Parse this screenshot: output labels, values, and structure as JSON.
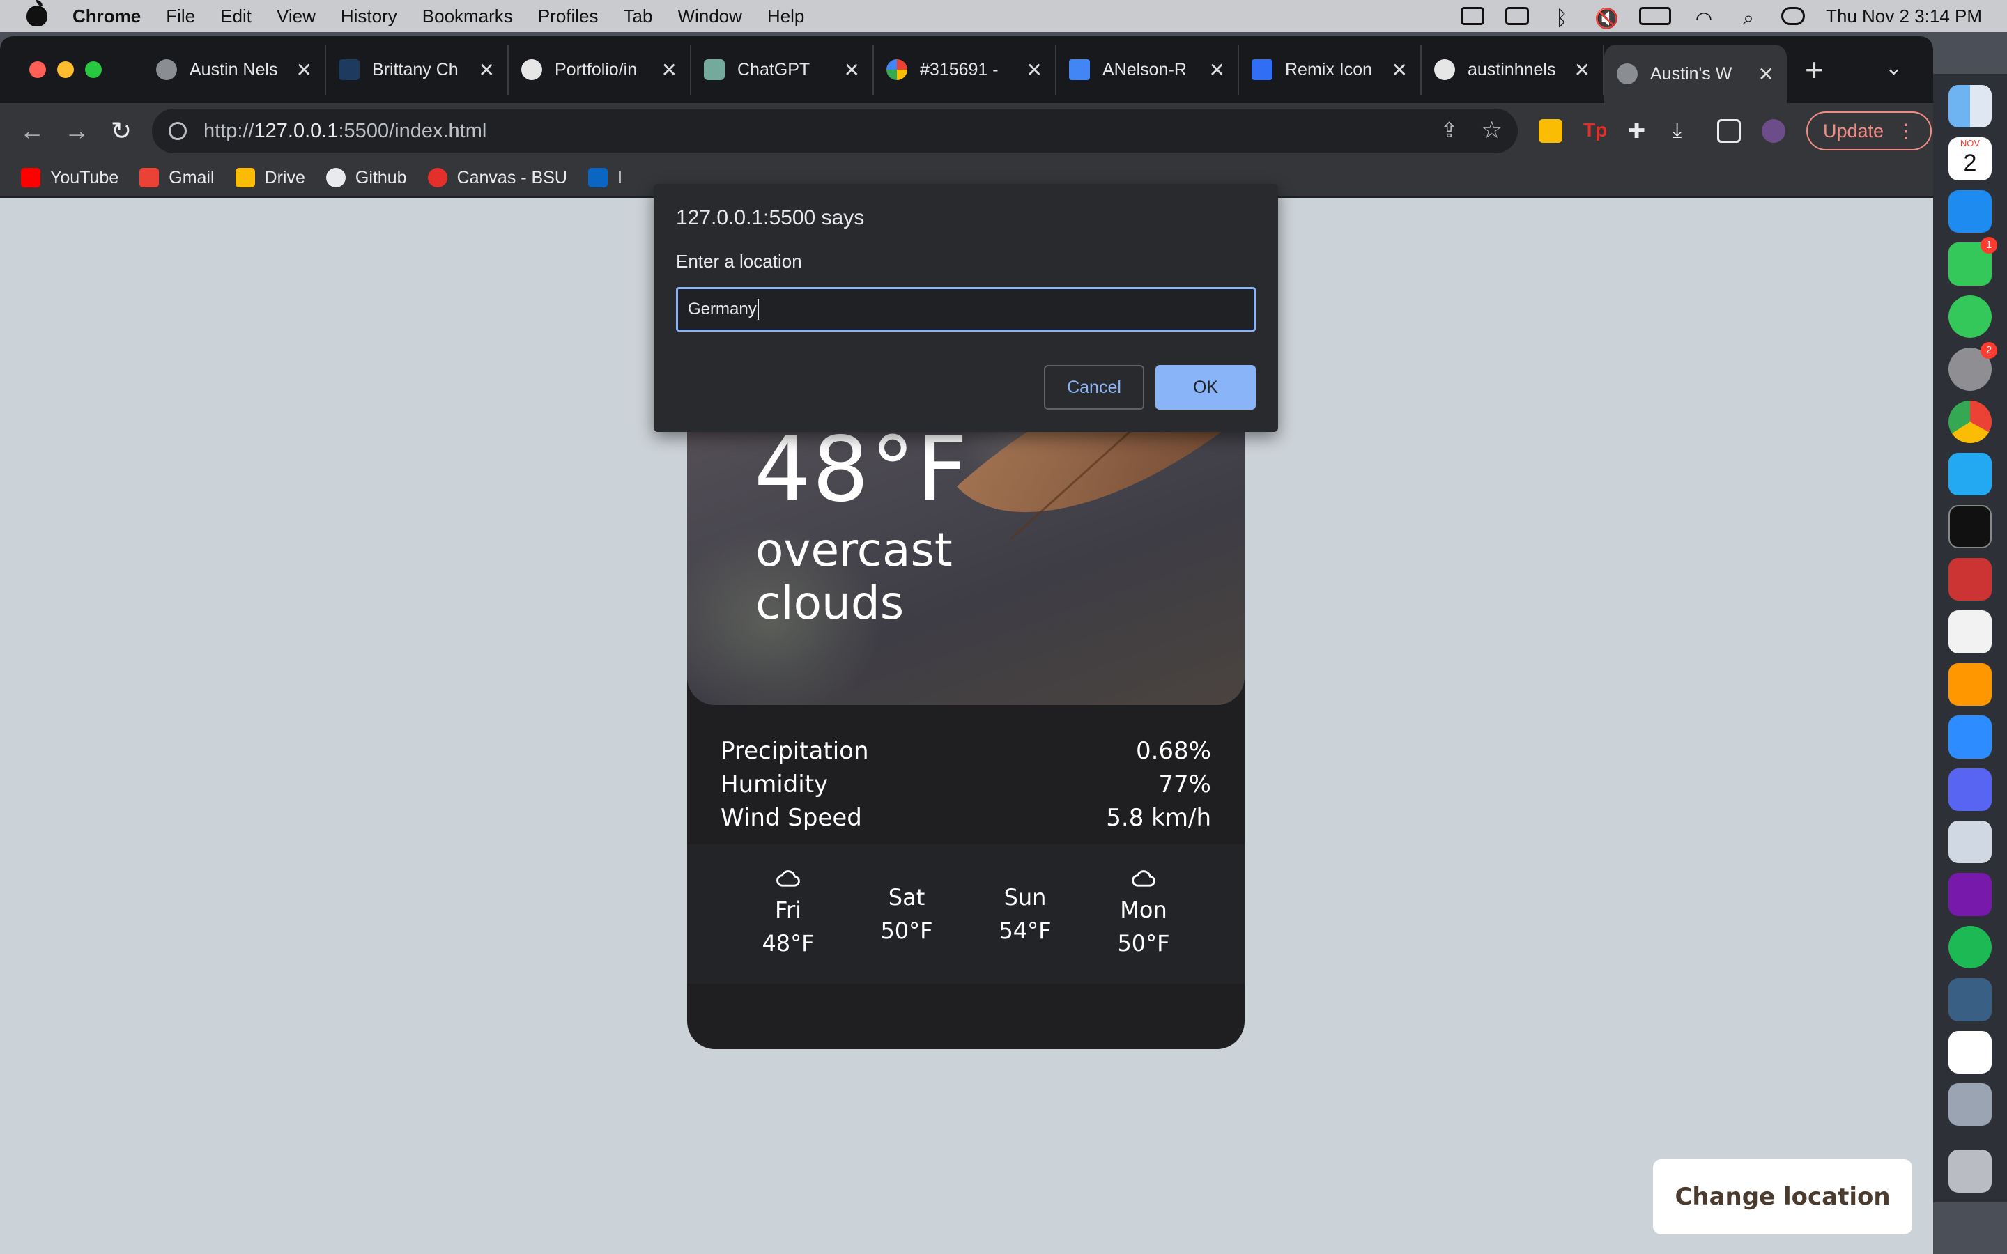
{
  "menubar": {
    "app_name": "Chrome",
    "items": [
      "File",
      "Edit",
      "View",
      "History",
      "Bookmarks",
      "Profiles",
      "Tab",
      "Window",
      "Help"
    ],
    "clock": "Thu Nov 2  3:14 PM"
  },
  "tabs": [
    {
      "label": "Austin Nels",
      "icon": "globe-icon",
      "color": "#8a8d92"
    },
    {
      "label": "Brittany Ch",
      "icon": "b-icon",
      "color": "#1e3a5f"
    },
    {
      "label": "Portfolio/in",
      "icon": "github-icon",
      "color": "#e6e6e6"
    },
    {
      "label": "ChatGPT",
      "icon": "chatgpt-icon",
      "color": "#74aa9c"
    },
    {
      "label": "#315691 -",
      "icon": "google-icon",
      "color": "#ea4335"
    },
    {
      "label": "ANelson-R",
      "icon": "docs-icon",
      "color": "#4285f4"
    },
    {
      "label": "Remix Icon",
      "icon": "remix-icon",
      "color": "#2f6ef5"
    },
    {
      "label": "austinhnels",
      "icon": "github-icon",
      "color": "#e6e6e6"
    },
    {
      "label": "Austin's W",
      "icon": "globe-icon",
      "color": "#8a8d92",
      "active": true
    }
  ],
  "address_bar": {
    "url_prefix": "http://",
    "url_host": "127.0.0.1",
    "url_rest": ":5500/index.html"
  },
  "toolbar": {
    "update_label": "Update"
  },
  "bookmarks": [
    {
      "label": "YouTube",
      "color": "#ff0000"
    },
    {
      "label": "Gmail",
      "color": "#ea4335"
    },
    {
      "label": "Drive",
      "color": "#fbbc04"
    },
    {
      "label": "Github",
      "color": "#e8eaed"
    },
    {
      "label": "Canvas - BSU",
      "color": "#e4302a"
    },
    {
      "label": "I",
      "color": "#0a66c2"
    }
  ],
  "dialog": {
    "title": "127.0.0.1:5500 says",
    "message": "Enter a location",
    "input_value": "Germany",
    "cancel_label": "Cancel",
    "ok_label": "OK"
  },
  "weather": {
    "icon": "cloud-icon",
    "temperature": "48°F",
    "description": "overcast clouds",
    "stats": [
      {
        "label": "Precipitation",
        "value": "0.68%"
      },
      {
        "label": "Humidity",
        "value": "77%"
      },
      {
        "label": "Wind Speed",
        "value": "5.8 km/h"
      }
    ],
    "forecast": [
      {
        "day": "Fri",
        "temp": "48°F",
        "icon": "cloud-icon"
      },
      {
        "day": "Sat",
        "temp": "50°F",
        "icon": ""
      },
      {
        "day": "Sun",
        "temp": "54°F",
        "icon": ""
      },
      {
        "day": "Mon",
        "temp": "50°F",
        "icon": "cloud-icon"
      }
    ]
  },
  "change_location_label": "Change location",
  "dock": {
    "calendar_month": "NOV",
    "calendar_day": "2",
    "badges": {
      "facetime": "1",
      "settings": "2"
    }
  }
}
